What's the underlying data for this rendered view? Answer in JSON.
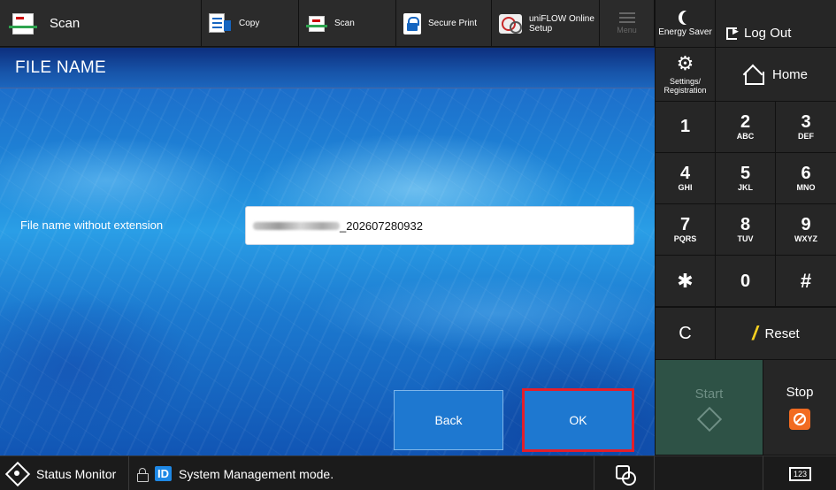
{
  "topbar": {
    "app_label": "Scan",
    "copy_label": "Copy",
    "scan_label": "Scan",
    "secure_print_label": "Secure Print",
    "uniflow_line1": "uniFLOW Online",
    "uniflow_line2": "Setup",
    "menu_label": "Menu"
  },
  "main": {
    "title": "FILE NAME",
    "field_label": "File name without extension",
    "field_value_suffix": "_202607280932",
    "back_label": "Back",
    "ok_label": "OK"
  },
  "right": {
    "energy_saver": "Energy Saver",
    "log_out": "Log Out",
    "settings_line1": "Settings/",
    "settings_line2": "Registration",
    "home": "Home",
    "keys": [
      {
        "digit": "1",
        "letters": ""
      },
      {
        "digit": "2",
        "letters": "ABC"
      },
      {
        "digit": "3",
        "letters": "DEF"
      },
      {
        "digit": "4",
        "letters": "GHI"
      },
      {
        "digit": "5",
        "letters": "JKL"
      },
      {
        "digit": "6",
        "letters": "MNO"
      },
      {
        "digit": "7",
        "letters": "PQRS"
      },
      {
        "digit": "8",
        "letters": "TUV"
      },
      {
        "digit": "9",
        "letters": "WXYZ"
      },
      {
        "digit": "✱",
        "letters": ""
      },
      {
        "digit": "0",
        "letters": ""
      },
      {
        "digit": "#",
        "letters": ""
      }
    ],
    "clear": "C",
    "reset": "Reset",
    "start": "Start",
    "stop": "Stop"
  },
  "statusbar": {
    "status_monitor": "Status Monitor",
    "id_badge": "ID",
    "message": "System Management mode.",
    "keyboard_label": "123"
  },
  "colors": {
    "ok_border": "#e41e2a",
    "button_blue": "#1e78d0",
    "start_green": "#2e5246",
    "stop_orange": "#f26b21",
    "reset_yellow": "#f5d020"
  }
}
